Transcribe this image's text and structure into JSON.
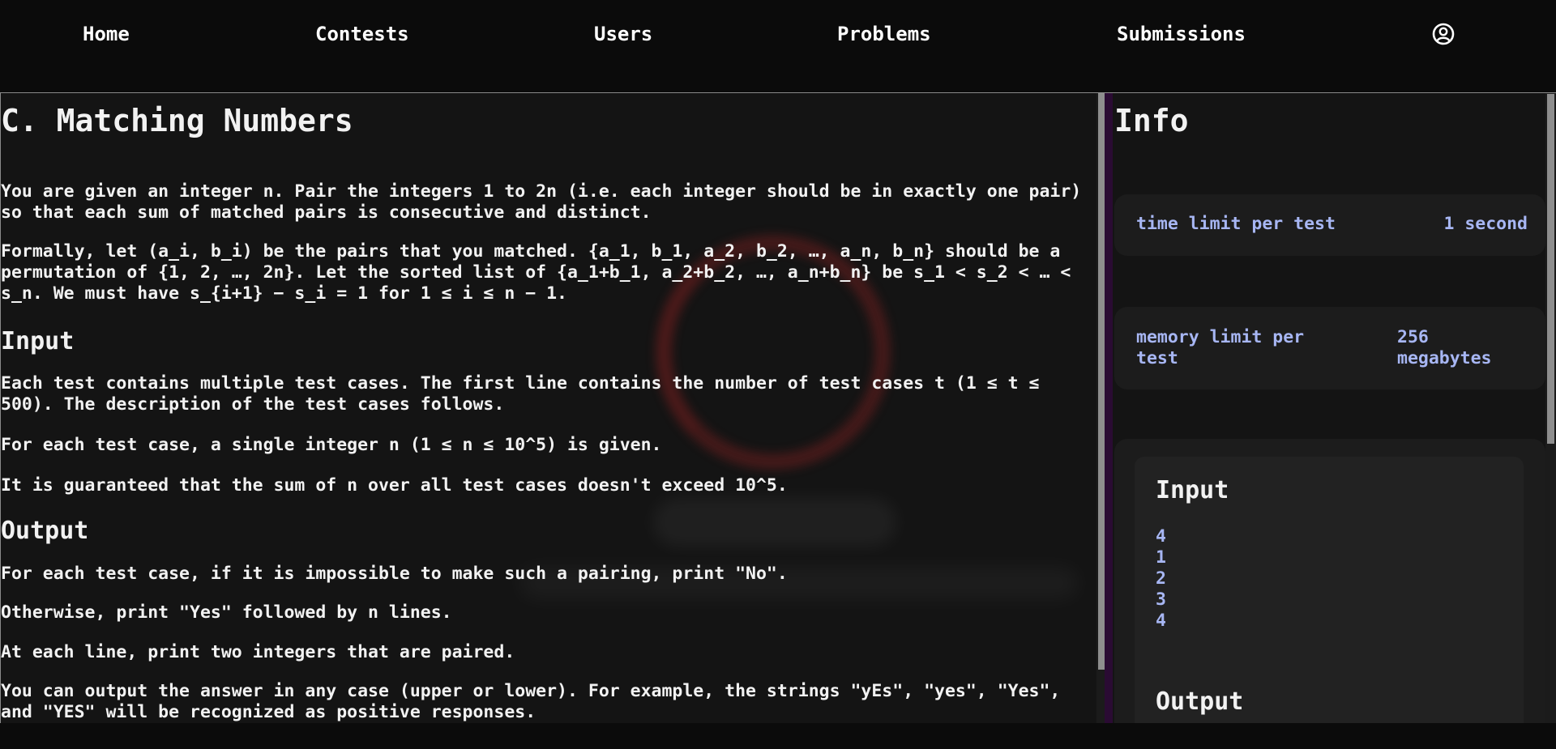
{
  "nav": {
    "home": "Home",
    "contests": "Contests",
    "users": "Users",
    "problems": "Problems",
    "submissions": "Submissions",
    "user_icon": "user-circle-icon"
  },
  "problem": {
    "title": "C. Matching Numbers",
    "statement": [
      "You are given an integer n. Pair the integers 1 to 2n (i.e. each integer should be in exactly one pair) so that each sum of matched pairs is consecutive and distinct.",
      "Formally, let (a_i, b_i) be the pairs that you matched. {a_1, b_1, a_2, b_2, …, a_n, b_n} should be a permutation of {1, 2, …, 2n}. Let the sorted list of {a_1+b_1, a_2+b_2, …, a_n+b_n} be s_1 < s_2 < … < s_n. We must have s_{i+1} − s_i = 1 for 1 ≤ i ≤ n − 1."
    ],
    "input_heading": "Input",
    "input": [
      "Each test contains multiple test cases. The first line contains the number of test cases t (1 ≤ t ≤ 500). The description of the test cases follows.",
      "For each test case, a single integer n (1 ≤ n ≤ 10^5) is given.",
      "It is guaranteed that the sum of n over all test cases doesn't exceed 10^5."
    ],
    "output_heading": "Output",
    "output": [
      "For each test case, if it is impossible to make such a pairing, print \"No\".",
      "Otherwise, print \"Yes\" followed by n lines.",
      "At each line, print two integers that are paired.",
      "You can output the answer in any case (upper or lower). For example, the strings \"yEs\", \"yes\", \"Yes\", and \"YES\" will be recognized as positive responses."
    ]
  },
  "info": {
    "title": "Info",
    "time_label": "time limit per test",
    "time_value": "1 second",
    "memory_label": "memory limit per test",
    "memory_value": "256 megabytes",
    "example": {
      "input_heading": "Input",
      "input_lines": [
        "4",
        "1",
        "2",
        "3",
        "4"
      ],
      "output_heading": "Output"
    }
  },
  "colors": {
    "background": "#0b0b0b",
    "panel": "#141414",
    "card": "#1c1c1c",
    "accent_text": "#a7b6f3",
    "info_accent": "#2a0b33"
  }
}
